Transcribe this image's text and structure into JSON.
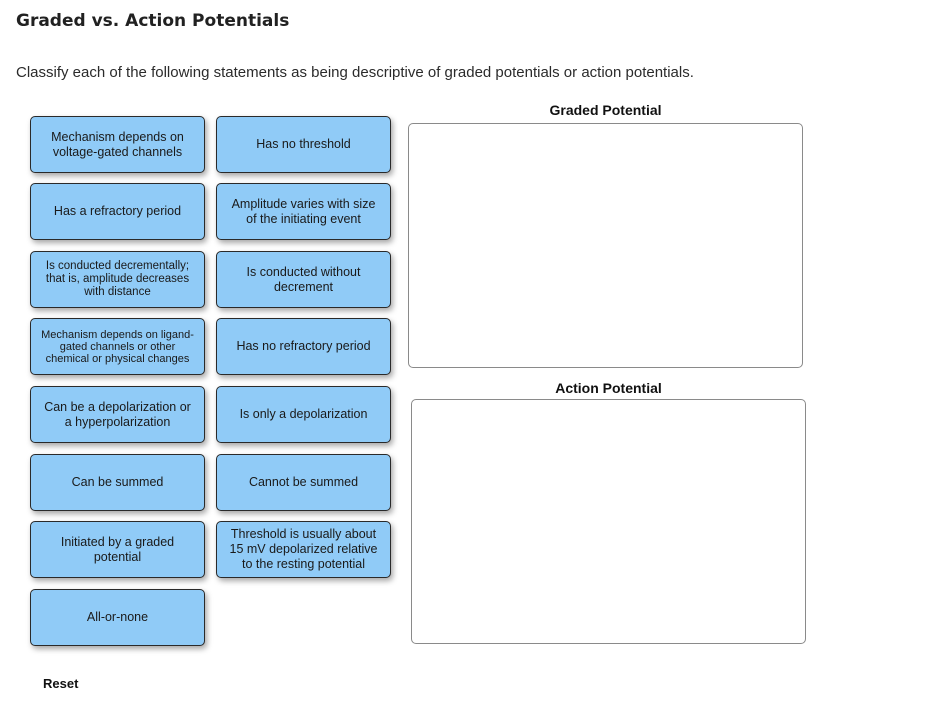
{
  "header": {
    "title": "Graded vs. Action Potentials",
    "instructions": "Classify each of the following statements as being descriptive of graded potentials or action potentials."
  },
  "cards": [
    {
      "label": "Mechanism depends on voltage-gated channels"
    },
    {
      "label": "Has no threshold"
    },
    {
      "label": "Has a refractory period"
    },
    {
      "label": "Amplitude varies with size of the initiating event"
    },
    {
      "label": "Is conducted decrementally; that is, amplitude decreases with distance"
    },
    {
      "label": "Is conducted without decrement"
    },
    {
      "label": "Mechanism depends on ligand-gated channels or other chemical or physical changes"
    },
    {
      "label": "Has no refractory period"
    },
    {
      "label": "Can be a depolarization or a hyperpolarization"
    },
    {
      "label": "Is only a depolarization"
    },
    {
      "label": "Can be summed"
    },
    {
      "label": "Cannot be summed"
    },
    {
      "label": "Initiated by a graded potential"
    },
    {
      "label": "Threshold is usually about 15 mV depolarized relative to the resting potential"
    },
    {
      "label": "All-or-none"
    }
  ],
  "zones": {
    "graded": {
      "label": "Graded Potential"
    },
    "action": {
      "label": "Action Potential"
    }
  },
  "controls": {
    "reset_label": "Reset"
  },
  "colors": {
    "card_fill": "#90cbf7",
    "card_border": "#2a2a2a",
    "zone_border": "#8a8a8a"
  }
}
